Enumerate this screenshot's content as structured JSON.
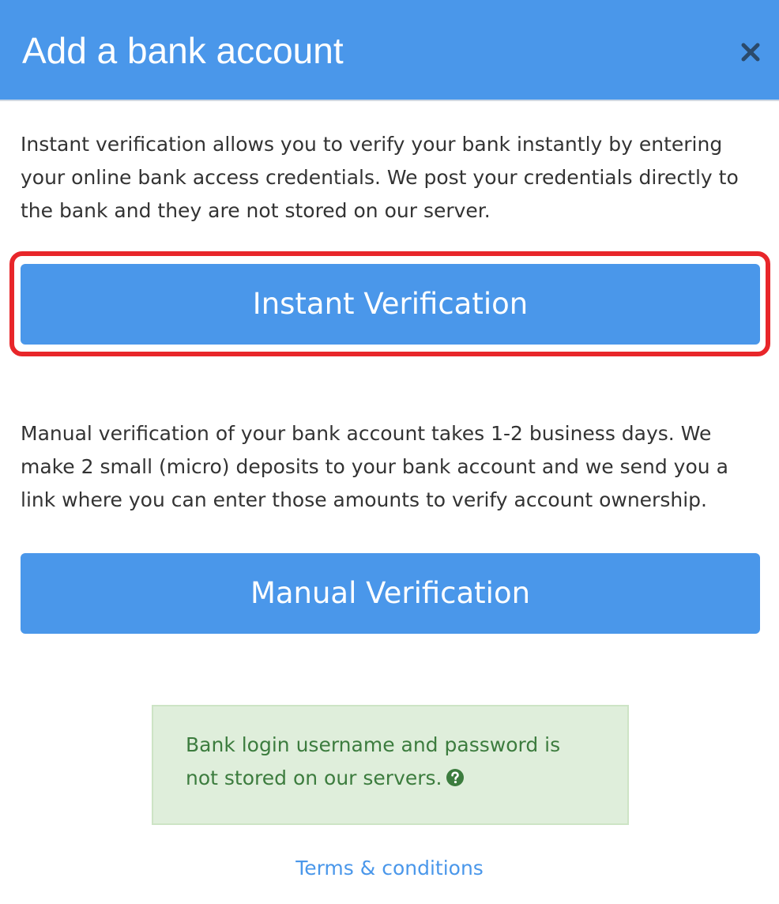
{
  "modal": {
    "title": "Add a bank account",
    "close_icon": "close-icon"
  },
  "instant": {
    "description": "Instant verification allows you to verify your bank instantly by entering your online bank access credentials. We post your credentials directly to the bank and they are not stored on our server.",
    "button_label": "Instant Verification"
  },
  "manual": {
    "description": "Manual verification of your bank account takes 1-2 business days. We make 2 small (micro) deposits to your bank account and we send you a link where you can enter those amounts to verify account ownership.",
    "button_label": "Manual Verification"
  },
  "notice": {
    "line1": "Bank login username and password is",
    "line2": "not stored on our servers.",
    "icon": "question-circle-icon"
  },
  "footer": {
    "terms_label": "Terms & conditions"
  },
  "colors": {
    "brand_blue": "#4a97ea",
    "highlight_red": "#e8262a",
    "notice_green_bg": "#dfeedb",
    "notice_green_text": "#3c7c3e"
  }
}
